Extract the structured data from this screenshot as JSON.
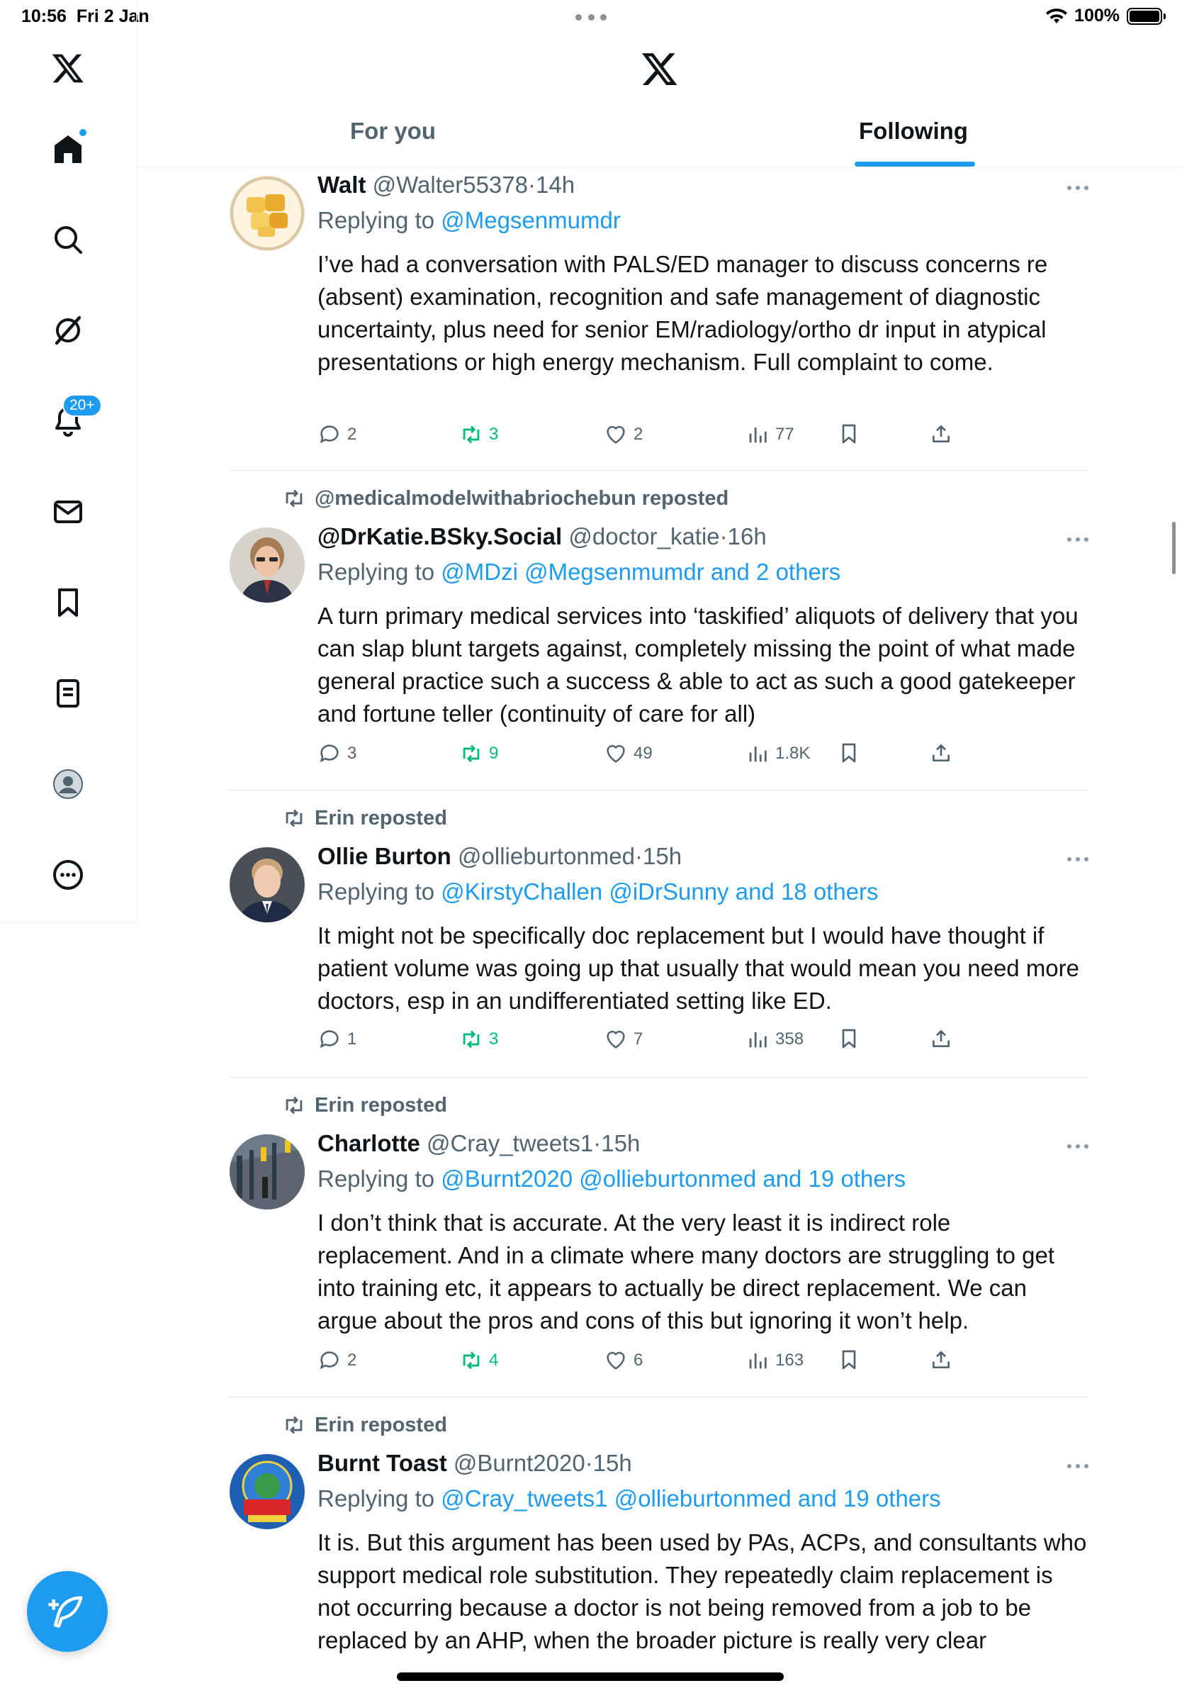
{
  "status_bar": {
    "time": "10:56",
    "date": "Fri 2 Jan",
    "battery": "100%",
    "wifi_icon": "wifi-icon",
    "battery_icon": "battery-icon"
  },
  "sidebar": {
    "items": [
      {
        "name": "x-logo",
        "icon": "x-logo-icon"
      },
      {
        "name": "home",
        "icon": "home-icon",
        "has_dot": true
      },
      {
        "name": "search",
        "icon": "search-icon"
      },
      {
        "name": "grok",
        "icon": "grok-icon"
      },
      {
        "name": "notifications",
        "icon": "bell-icon",
        "badge": "20+"
      },
      {
        "name": "messages",
        "icon": "mail-icon"
      },
      {
        "name": "bookmarks",
        "icon": "bookmark-icon"
      },
      {
        "name": "lists",
        "icon": "list-icon"
      },
      {
        "name": "profile",
        "icon": "profile-icon"
      },
      {
        "name": "more",
        "icon": "more-circle-icon"
      }
    ],
    "badge_count": "20+"
  },
  "header": {
    "tabs": [
      {
        "label": "For you",
        "active": false
      },
      {
        "label": "Following",
        "active": true
      }
    ]
  },
  "accent_color": "#1d9bf0",
  "repost_color": "#00ba7c",
  "posts": [
    {
      "repost_by": "",
      "name": "Walt",
      "handle": "@Walter55378",
      "time": "14h",
      "replying_prefix": "Replying to ",
      "replying_to": "@Megsenmumdr",
      "text": "I’ve had a conversation with PALS/ED manager to discuss concerns re (absent) examination, recognition and safe management of diagnostic uncertainty, plus need for senior EM/radiology/ortho dr input in atypical presentations or high energy mechanism. Full complaint to come.",
      "replies": "2",
      "reposts": "3",
      "likes": "2",
      "views": "77"
    },
    {
      "repost_by": "@medicalmodelwithabriochebun reposted",
      "name": "@DrKatie.BSky.Social",
      "handle": "@doctor_katie",
      "time": "16h",
      "replying_prefix": "Replying to ",
      "replying_to": "@MDzi @Megsenmumdr and 2 others",
      "text": "A turn primary medical services into ‘taskified’ aliquots of delivery that you can slap blunt targets against, completely missing the point of what made general practice such a success & able to act as such a good gatekeeper and fortune teller (continuity of care for all)",
      "replies": "3",
      "reposts": "9",
      "likes": "49",
      "views": "1.8K"
    },
    {
      "repost_by": "Erin reposted",
      "name": "Ollie Burton",
      "handle": "@ollieburtonmed",
      "time": "15h",
      "replying_prefix": "Replying to ",
      "replying_to": "@KirstyChallen @iDrSunny and 18 others",
      "text": "It might not be specifically doc replacement but I would have thought if patient volume was going up that usually that would mean you need more doctors, esp in an undifferentiated setting like ED.",
      "replies": "1",
      "reposts": "3",
      "likes": "7",
      "views": "358"
    },
    {
      "repost_by": "Erin reposted",
      "name": "Charlotte",
      "handle": "@Cray_tweets1",
      "time": "15h",
      "replying_prefix": "Replying to ",
      "replying_to": "@Burnt2020 @ollieburtonmed and 19 others",
      "text": "I don’t think that is accurate. At the very least it is indirect role replacement. And in a climate where many doctors are struggling to get into training etc, it appears to actually be direct replacement. We can argue about the pros and cons of this but ignoring it won’t help.",
      "replies": "2",
      "reposts": "4",
      "likes": "6",
      "views": "163"
    },
    {
      "repost_by": "Erin reposted",
      "name": "Burnt Toast",
      "handle": "@Burnt2020",
      "time": "15h",
      "replying_prefix": "Replying to ",
      "replying_to": "@Cray_tweets1 @ollieburtonmed and 19 others",
      "text": "It is. But this argument has been used by PAs, ACPs, and consultants who support medical role substitution. They repeatedly claim replacement is not occurring because a doctor is not being removed from a job to be replaced by an AHP, when the broader picture is really very clear"
    }
  ]
}
